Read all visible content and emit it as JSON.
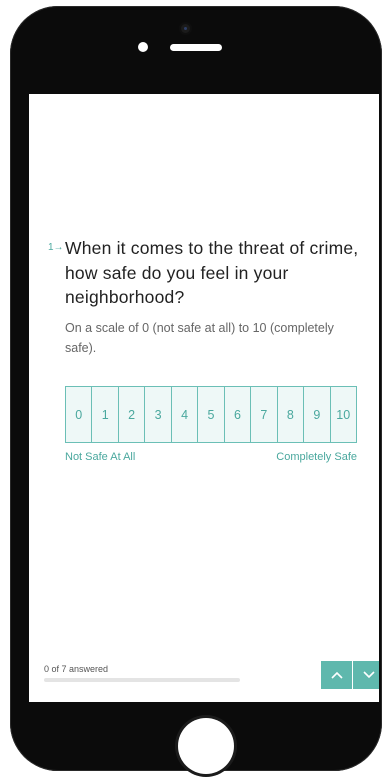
{
  "question": {
    "number": "1→",
    "text": "When it comes to the threat of crime, how safe do you feel in your neighborhood?",
    "description": "On a scale of 0 (not safe at all) to 10 (completely safe)."
  },
  "scale": {
    "options": [
      "0",
      "1",
      "2",
      "3",
      "4",
      "5",
      "6",
      "7",
      "8",
      "9",
      "10"
    ],
    "left_label": "Not Safe At All",
    "right_label": "Completely Safe"
  },
  "footer": {
    "answered_text": "0 of 7 answered",
    "progress_fraction": 0
  },
  "icons": {
    "prev": "chevron-up-icon",
    "next": "chevron-down-icon"
  },
  "colors": {
    "accent": "#4aa89e",
    "scale_background": "#eef8f7",
    "nav_button": "#5fb8ad"
  }
}
